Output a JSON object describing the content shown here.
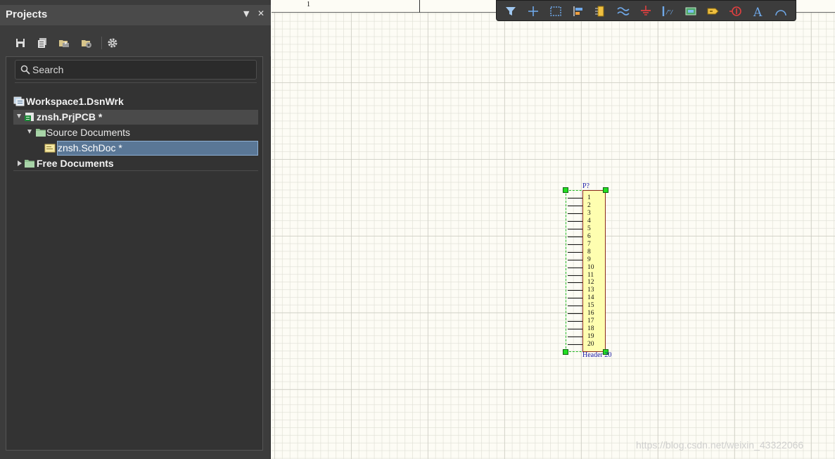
{
  "panel": {
    "title": "Projects",
    "search": {
      "placeholder": "Search",
      "value": ""
    },
    "tree": {
      "workspace": "Workspace1.DsnWrk",
      "project": "znsh.PrjPCB *",
      "source_folder": "Source Documents",
      "document": "znsh.SchDoc *",
      "free_folder": "Free Documents"
    }
  },
  "canvas": {
    "ruler_label": "1",
    "component": {
      "designator": "P?",
      "comment": "Header 20",
      "pins": [
        "1",
        "2",
        "3",
        "4",
        "5",
        "6",
        "7",
        "8",
        "9",
        "10",
        "11",
        "12",
        "13",
        "14",
        "15",
        "16",
        "17",
        "18",
        "19",
        "20"
      ]
    },
    "watermark": "https://blog.csdn.net/weixin_43322066"
  },
  "colors": {
    "panel_bg": "#3c3c3c",
    "selection": "#5a7796",
    "component_fill": "#fefeb0",
    "designator_text": "#1a1aa8",
    "handle": "#22dd22"
  }
}
